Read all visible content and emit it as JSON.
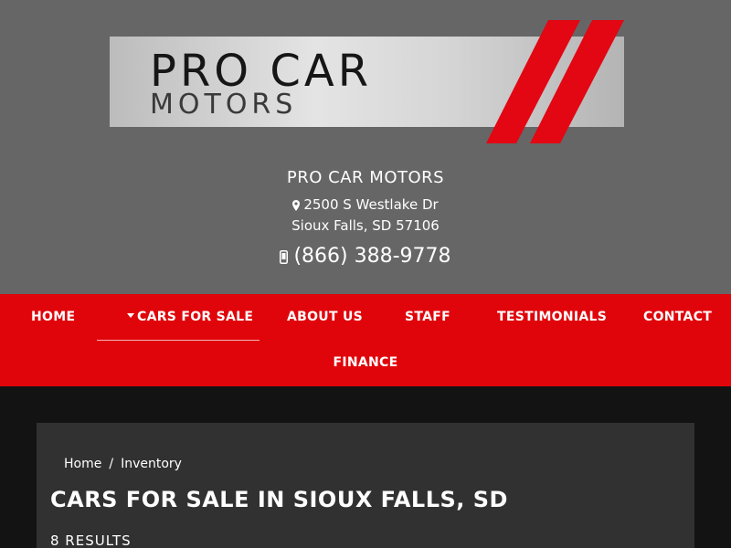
{
  "logo": {
    "line1": "PRO CAR",
    "line2": "MOTORS"
  },
  "dealer": {
    "name": "PRO CAR MOTORS",
    "address_line1": "2500 S Westlake Dr",
    "address_line2": "Sioux Falls, SD 57106",
    "phone": "(866) 388-9778"
  },
  "icons": {
    "address": "map-pin-icon",
    "phone": "mobile-phone-icon",
    "dropdown": "caret-down-icon"
  },
  "nav": {
    "home": "HOME",
    "cars_for_sale": "CARS FOR SALE",
    "about_us": "ABOUT US",
    "staff": "STAFF",
    "testimonials": "TESTIMONIALS",
    "contact": "CONTACT",
    "finance": "FINANCE"
  },
  "breadcrumb": {
    "home": "Home",
    "separator": "/",
    "current": "Inventory"
  },
  "page": {
    "title": "CARS FOR SALE IN SIOUX FALLS, SD",
    "results": "8 RESULTS"
  },
  "colors": {
    "header_bg": "#666666",
    "nav_bg": "#e0050b",
    "page_bg": "#131313",
    "content_bg": "#313131",
    "brand_red": "#e0050b"
  }
}
